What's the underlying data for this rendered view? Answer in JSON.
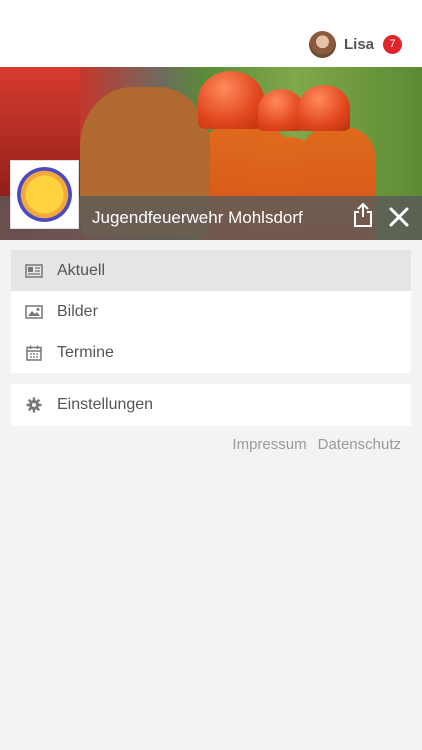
{
  "user": {
    "name": "Lisa",
    "notifications": "7",
    "avatar_icon": "user-avatar"
  },
  "hero": {
    "image": "firefighters-helmets-photo"
  },
  "brand": {
    "title": "Jugendfeuerwehr Mohlsdorf",
    "logo_icon": "jugendfeuerwehr-logo",
    "logo_text": "Jugendfeuerwehr Mohlsdorf"
  },
  "actions": {
    "share_icon": "share-icon",
    "close_icon": "close-icon"
  },
  "menu": {
    "primary": [
      {
        "label": "Aktuell",
        "icon": "newspaper-icon",
        "active": true
      },
      {
        "label": "Bilder",
        "icon": "image-icon",
        "active": false
      },
      {
        "label": "Termine",
        "icon": "calendar-icon",
        "active": false
      }
    ],
    "secondary": [
      {
        "label": "Einstellungen",
        "icon": "gear-icon",
        "active": false
      }
    ]
  },
  "footer": {
    "impressum": "Impressum",
    "datenschutz": "Datenschutz"
  },
  "colors": {
    "badge": "#e2232a",
    "brandbar": "#5a5a5a",
    "active_item": "#e5e5e5",
    "background": "#f3f3f3"
  }
}
